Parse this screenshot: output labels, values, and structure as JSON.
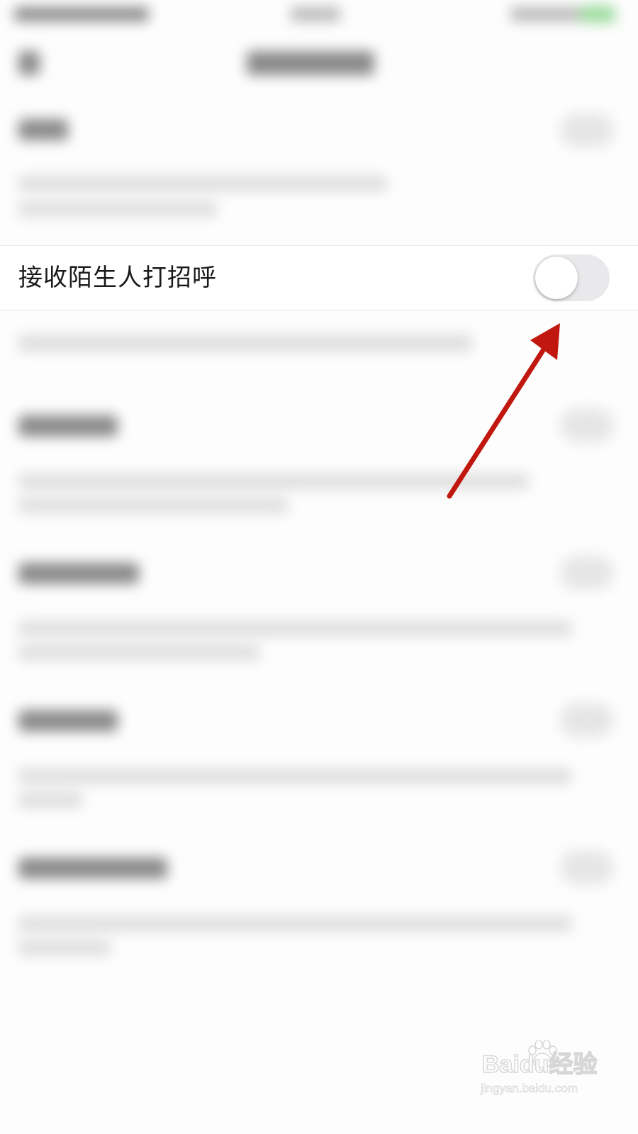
{
  "setting": {
    "label": "接收陌生人打招呼",
    "toggle_state": "off"
  },
  "colors": {
    "arrow": "#c0170f",
    "toggle_track_off": "#e9e9eb",
    "row_background": "#ffffff"
  },
  "watermark": {
    "logo_text": "Baidu经验",
    "url": "jingyan.baidu.com"
  },
  "icons": [
    "annotation-arrow",
    "baidu-paw-logo"
  ]
}
